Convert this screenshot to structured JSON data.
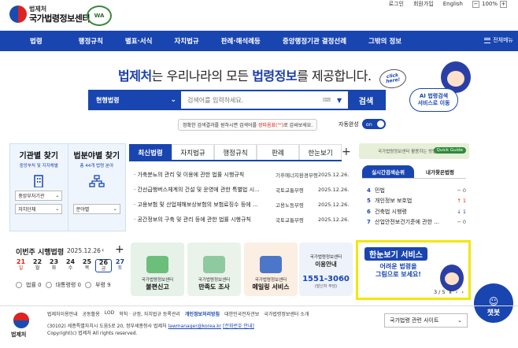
{
  "header": {
    "logo_small": "법제처",
    "logo_big": "국가법령정보센터",
    "wa_badge": "WA",
    "links": [
      "로그인",
      "회원가입",
      "English"
    ],
    "zoom_minus": "−",
    "zoom": "100%",
    "zoom_plus": "+"
  },
  "nav": {
    "items": [
      "법령",
      "행정규칙",
      "별표·서식",
      "자치법규",
      "판례·해석례등",
      "중앙행정기관 결정선례",
      "그밖의 정보"
    ],
    "all_menu": "전체메뉴"
  },
  "hero": {
    "title_brand": "법제처",
    "title_mid": "는 우리나라의 모든 ",
    "title_key": "법령정보",
    "title_end": "를 제공합니다."
  },
  "search": {
    "category": "현행법령",
    "placeholder": "검색어를 입력하세요.",
    "button": "검색",
    "hint_pre": "정확한 검색결과를 원하시면 검색어를 ",
    "hint_red": "쌍따옴표(\"\")",
    "hint_post": "로 감싸보세요.",
    "autocomplete_label": "자동완성",
    "autocomplete_state": "on"
  },
  "promo_ai": {
    "click": "click here!",
    "line1": "AI 법령검색",
    "line2": "서비스로 이동"
  },
  "tiles": [
    {
      "title": "기관별 찾기",
      "sub": "중앙부처 및 지자체별",
      "select1": "중앙부처기관",
      "select2": "자치단체"
    },
    {
      "title": "법분야별 찾기",
      "sub": "총 44개 법령 분야",
      "select1": "분야별"
    }
  ],
  "law_tabs": [
    "최신법령",
    "자치법규",
    "행정규칙",
    "판례",
    "한눈보기"
  ],
  "law_tabs_more": "+",
  "laws": [
    {
      "title": "· 가축분뇨의 관리 및 이용에 관한 법률 시행규칙",
      "dept": "기후에너지환경부령",
      "date": "2025.12.26."
    },
    {
      "title": "· 간선급행버스체계의 건설 및 운영에 관한 특별법 시...",
      "dept": "국토교통부령",
      "date": "2025.12.26."
    },
    {
      "title": "· 고용보험 및 산업재해보상보험의 보험료징수 등에 ...",
      "dept": "고용노동부령",
      "date": "2025.12.26."
    },
    {
      "title": "· 공간정보의 구축 및 관리 등에 관한 법률 시행규칙",
      "dept": "국토교통부령",
      "date": "2025.12.26."
    }
  ],
  "rank": {
    "banner": "국가법령정보센터 활용하는 방법",
    "guide": "Quick Guide",
    "tabs": [
      "실시간검색순위",
      "내가찾은법령"
    ],
    "items": [
      {
        "num": "4",
        "name": "민법",
        "change": "− 0",
        "dir": "same"
      },
      {
        "num": "5",
        "name": "개인정보 보호법",
        "change": "↑ 1",
        "dir": "up"
      },
      {
        "num": "6",
        "name": "건축법 시행령",
        "change": "↓ 1",
        "dir": "down"
      },
      {
        "num": "7",
        "name": "산업안전보건기준에 관한 ...",
        "change": "− 0",
        "dir": "same"
      }
    ]
  },
  "calendar": {
    "title": "이번주 시행법령",
    "date": "2025.12.26",
    "prev": "‹",
    "plus": "+",
    "days": [
      {
        "d": "21",
        "w": "일",
        "cls": "sun"
      },
      {
        "d": "22",
        "w": "월",
        "cls": ""
      },
      {
        "d": "23",
        "w": "화",
        "cls": ""
      },
      {
        "d": "24",
        "w": "수",
        "cls": ""
      },
      {
        "d": "25",
        "w": "목",
        "cls": ""
      },
      {
        "d": "26",
        "w": "금",
        "cls": "today"
      },
      {
        "d": "27",
        "w": "토",
        "cls": "sat"
      }
    ],
    "legend": [
      "법률 0",
      "대통령령 0",
      "부령 9"
    ]
  },
  "cards": [
    {
      "l1": "국가법령정보센터",
      "l2": "불편신고",
      "color": "#e6f1e8",
      "pic": "#6bbf7a"
    },
    {
      "l1": "국가법령정보센터",
      "l2": "만족도 조사",
      "color": "#eaf3ea",
      "pic": "#8fc9a0"
    },
    {
      "l1": "국가법령정보센터",
      "l2": "메일링 서비스",
      "color": "#fbeee3",
      "pic": "#4c76c8"
    }
  ],
  "phone": {
    "l1": "국가법령정보센터",
    "l2": "이용안내",
    "number": "1551-3060",
    "note": "(발신자 부담)"
  },
  "promo": {
    "title": "한눈보기 서비스",
    "sub1": "어려운 법령을",
    "sub2": "그림으로 보세요!",
    "page": "3 / 5",
    "pause": "Ⅱ",
    "prev": "‹",
    "next": "›"
  },
  "chatbot": "챗봇",
  "footer": {
    "name": "법제처",
    "links": [
      "법제처이용안내",
      "공동활용",
      "LOD",
      "학칙 · 규정, 자치법규 등록관리",
      "개인정보처리방침",
      "대한민국전자관보",
      "국가법령정보센터 소개"
    ],
    "address": "(30102) 세종특별자치시 도움5로 20, 정부세종청사 법제처",
    "email": "lawmanager@korea.kr",
    "email_link": "[전화번호 안내]",
    "copy": "Copyright(c) 법제처 All rights reserved.",
    "site_select": "국가법령 관련 사이트"
  },
  "colors": {
    "primary": "#1945b0",
    "accent_red": "#d21111",
    "promo_border": "#f2e800"
  }
}
